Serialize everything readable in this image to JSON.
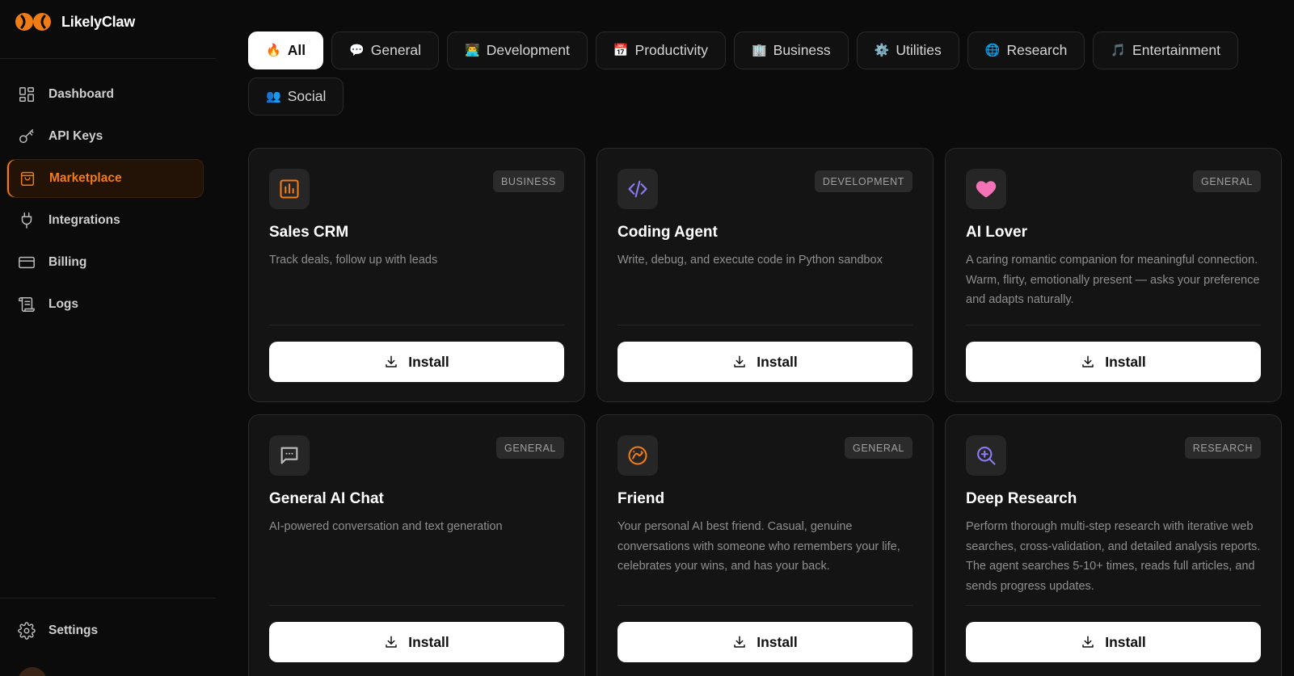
{
  "app": {
    "title": "LikelyClaw"
  },
  "colors": {
    "accent": "#f07c16",
    "background": "#0b0b0b",
    "card": "#141414"
  },
  "sidebar": {
    "items": [
      {
        "label": "Dashboard",
        "icon": "dashboard-icon"
      },
      {
        "label": "API Keys",
        "icon": "key-icon"
      },
      {
        "label": "Marketplace",
        "icon": "bag-icon",
        "active": true
      },
      {
        "label": "Integrations",
        "icon": "plug-icon"
      },
      {
        "label": "Billing",
        "icon": "credit-card-icon"
      },
      {
        "label": "Logs",
        "icon": "scroll-icon"
      }
    ],
    "settings_label": "Settings"
  },
  "filters": [
    {
      "label": "All",
      "emoji": "🔥",
      "active": true
    },
    {
      "label": "General",
      "emoji": "💬"
    },
    {
      "label": "Development",
      "emoji": "👨‍💻"
    },
    {
      "label": "Productivity",
      "emoji": "📅"
    },
    {
      "label": "Business",
      "emoji": "🏢"
    },
    {
      "label": "Utilities",
      "emoji": "⚙️"
    },
    {
      "label": "Research",
      "emoji": "🌐"
    },
    {
      "label": "Entertainment",
      "emoji": "🎵"
    },
    {
      "label": "Social",
      "emoji": "👥"
    }
  ],
  "agents": [
    {
      "name": "Sales CRM",
      "category": "BUSINESS",
      "description": "Track deals, follow up with leads",
      "icon": "bar-chart-icon",
      "icon_color": "#f07c16",
      "install_label": "Install"
    },
    {
      "name": "Coding Agent",
      "category": "DEVELOPMENT",
      "description": "Write, debug, and execute code in Python sandbox",
      "icon": "code-icon",
      "icon_color": "#8b7cf6",
      "install_label": "Install"
    },
    {
      "name": "AI Lover",
      "category": "GENERAL",
      "description": "A caring romantic companion for meaningful connection. Warm, flirty, emotionally present — asks your preference and adapts naturally.",
      "icon": "heart-icon",
      "icon_color": "#f472b6",
      "install_label": "Install"
    },
    {
      "name": "General AI Chat",
      "category": "GENERAL",
      "description": "AI-powered conversation and text generation",
      "icon": "chat-icon",
      "icon_color": "#bdbdbd",
      "install_label": "Install"
    },
    {
      "name": "Friend",
      "category": "GENERAL",
      "description": "Your personal AI best friend. Casual, genuine conversations with someone who remembers your life, celebrates your wins, and has your back.",
      "icon": "smile-icon",
      "icon_color": "#f07c16",
      "install_label": "Install"
    },
    {
      "name": "Deep Research",
      "category": "RESEARCH",
      "description": "Perform thorough multi-step research with iterative web searches, cross-validation, and detailed analysis reports. The agent searches 5-10+ times, reads full articles, and sends progress updates.",
      "icon": "zoom-in-icon",
      "icon_color": "#8b7cf6",
      "install_label": "Install"
    }
  ]
}
